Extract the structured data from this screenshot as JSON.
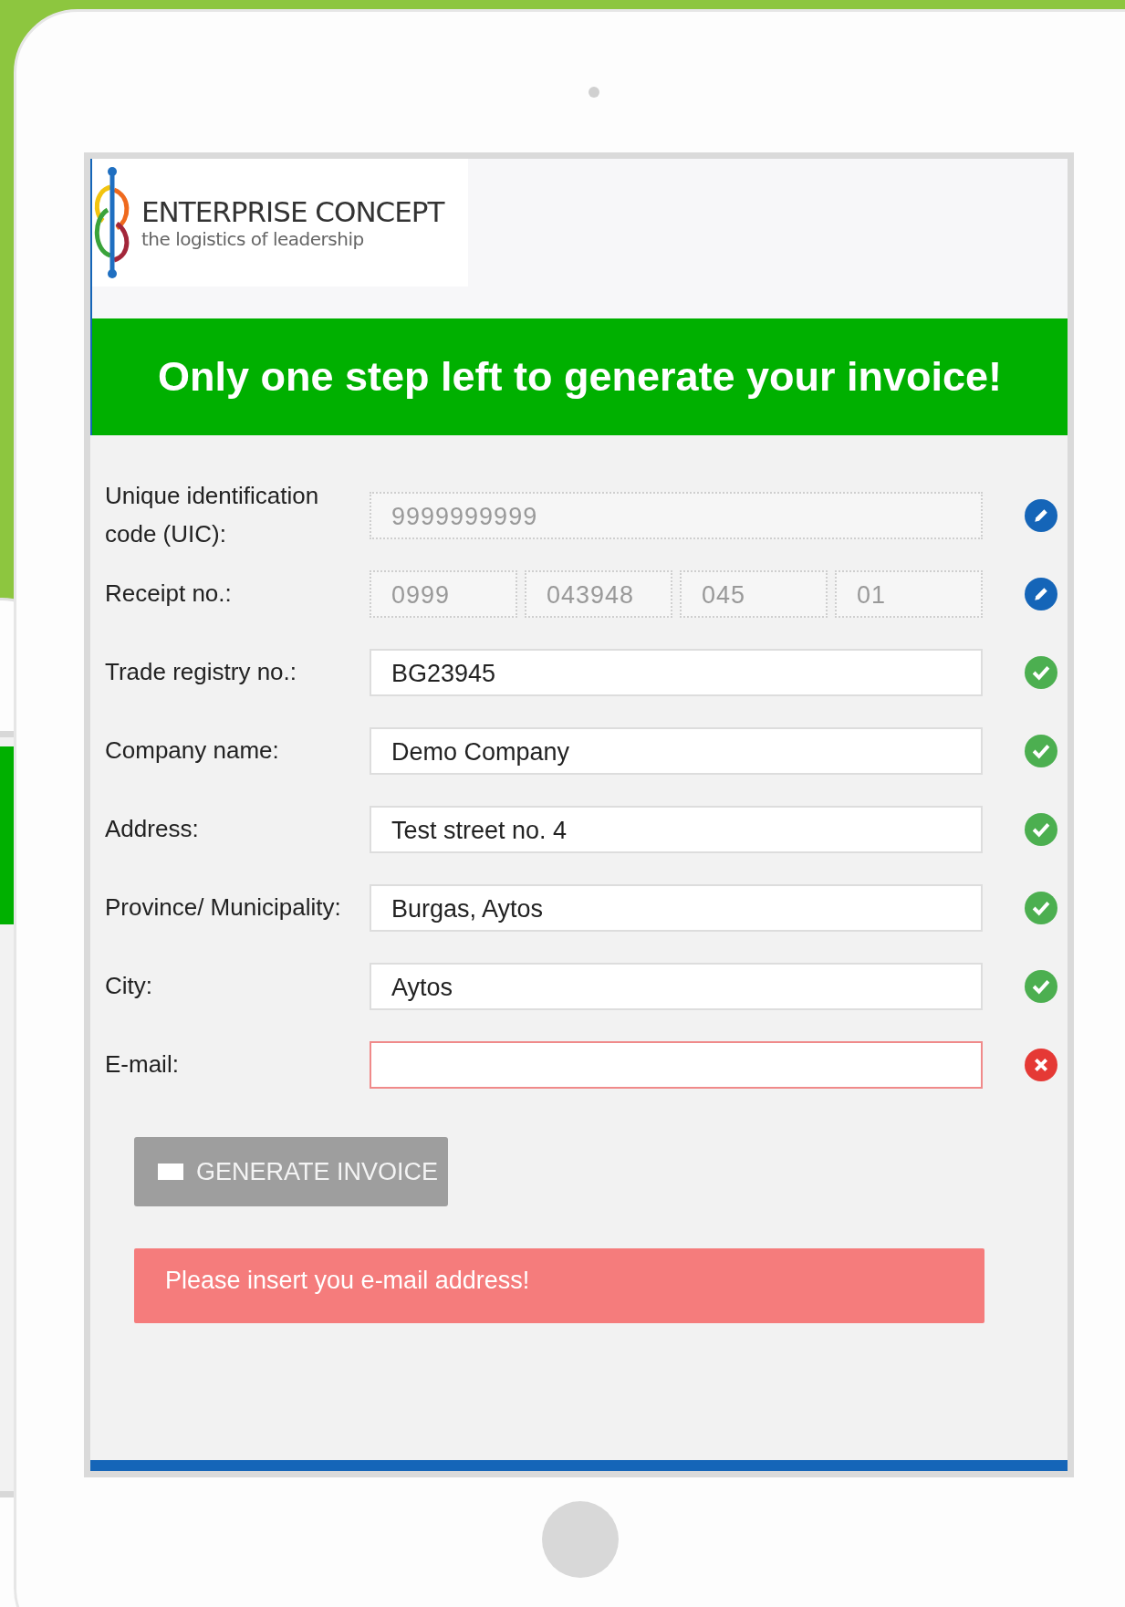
{
  "logo": {
    "title": "ENTERPRISE CONCEPT",
    "subtitle": "the logistics of leadership"
  },
  "banner": {
    "title": "Only one step left to generate your invoice!"
  },
  "form": {
    "fields": [
      {
        "label": "Unique identification code (UIC):",
        "kind": "single",
        "values": [
          "9999999999"
        ],
        "disabled": true,
        "indicator": {
          "kind": "edit"
        }
      },
      {
        "label": "Receipt no.:",
        "kind": "split",
        "values": [
          "0999",
          "043948",
          "045",
          "01"
        ],
        "disabled": true,
        "indicator": {
          "kind": "edit"
        }
      },
      {
        "label": "Trade registry no.:",
        "kind": "single",
        "values": [
          "BG23945"
        ],
        "disabled": false,
        "indicator": {
          "kind": "valid"
        }
      },
      {
        "label": "Company name:",
        "kind": "single",
        "values": [
          "Demo Company"
        ],
        "disabled": false,
        "indicator": {
          "kind": "valid"
        }
      },
      {
        "label": "Address:",
        "kind": "single",
        "values": [
          "Test street no. 4"
        ],
        "disabled": false,
        "indicator": {
          "kind": "valid"
        }
      },
      {
        "label": "Province/ Municipality:",
        "kind": "single",
        "values": [
          "Burgas, Aytos"
        ],
        "disabled": false,
        "indicator": {
          "kind": "valid"
        }
      },
      {
        "label": "City:",
        "kind": "single",
        "values": [
          "Aytos"
        ],
        "disabled": false,
        "indicator": {
          "kind": "valid"
        }
      },
      {
        "label": "E-mail:",
        "kind": "single",
        "disabled": false,
        "indicator": {
          "kind": "invalid"
        }
      }
    ],
    "button": {
      "label": "GENERATE INVOICE",
      "disabled": true
    },
    "error": "Please insert you e-mail address!"
  }
}
